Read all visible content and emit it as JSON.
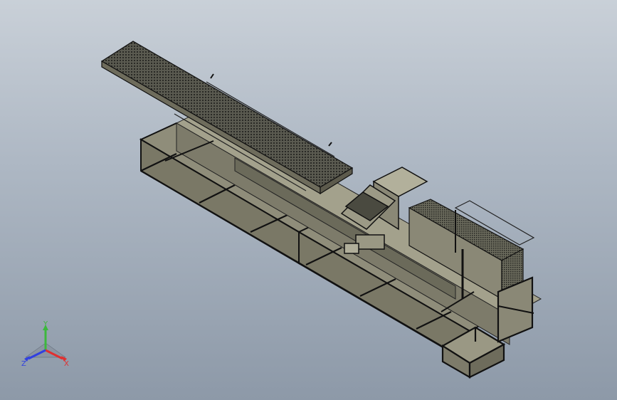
{
  "viewport": {
    "background_top": "#c9d0d8",
    "background_bottom": "#8d99a8"
  },
  "model": {
    "body_color": "#7d7b6a",
    "dark_color": "#3a3a34",
    "light_color": "#9a9884",
    "edge_color": "#111111"
  },
  "triad": {
    "x_label": "X",
    "y_label": "Y",
    "z_label": "Z",
    "x_color": "#e03030",
    "y_color": "#3cb83c",
    "z_color": "#3040e0"
  }
}
